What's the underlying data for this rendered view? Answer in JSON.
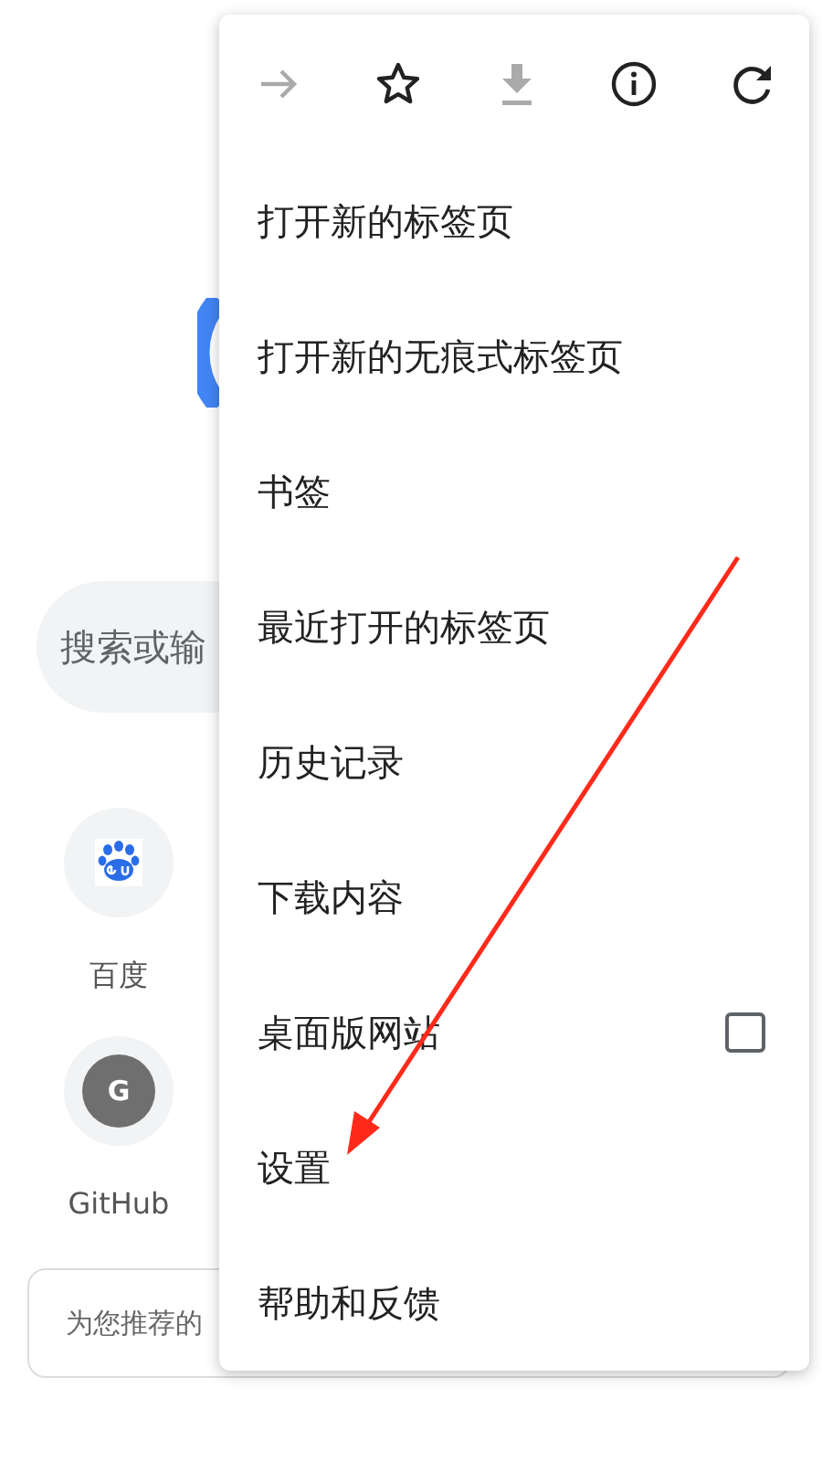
{
  "search": {
    "placeholder": "搜索或输"
  },
  "shortcuts": [
    {
      "kind": "paw",
      "label": "百度"
    },
    {
      "kind": "letter",
      "letter": "G",
      "label": "GitHub"
    }
  ],
  "feed_card": {
    "text": "为您推荐的"
  },
  "menu": {
    "toolbar": [
      {
        "kind": "forward",
        "disabled": true
      },
      {
        "kind": "star",
        "disabled": false
      },
      {
        "kind": "download",
        "disabled": true
      },
      {
        "kind": "info",
        "disabled": false
      },
      {
        "kind": "reload",
        "disabled": false
      }
    ],
    "items": [
      {
        "kind": "plain",
        "label": "打开新的标签页"
      },
      {
        "kind": "plain",
        "label": "打开新的无痕式标签页"
      },
      {
        "kind": "plain",
        "label": "书签"
      },
      {
        "kind": "plain",
        "label": "最近打开的标签页"
      },
      {
        "kind": "plain",
        "label": "历史记录"
      },
      {
        "kind": "plain",
        "label": "下载内容"
      },
      {
        "kind": "checkbox",
        "label": "桌面版网站",
        "checked": false
      },
      {
        "kind": "plain",
        "label": "设置"
      },
      {
        "kind": "plain",
        "label": "帮助和反馈"
      }
    ]
  }
}
